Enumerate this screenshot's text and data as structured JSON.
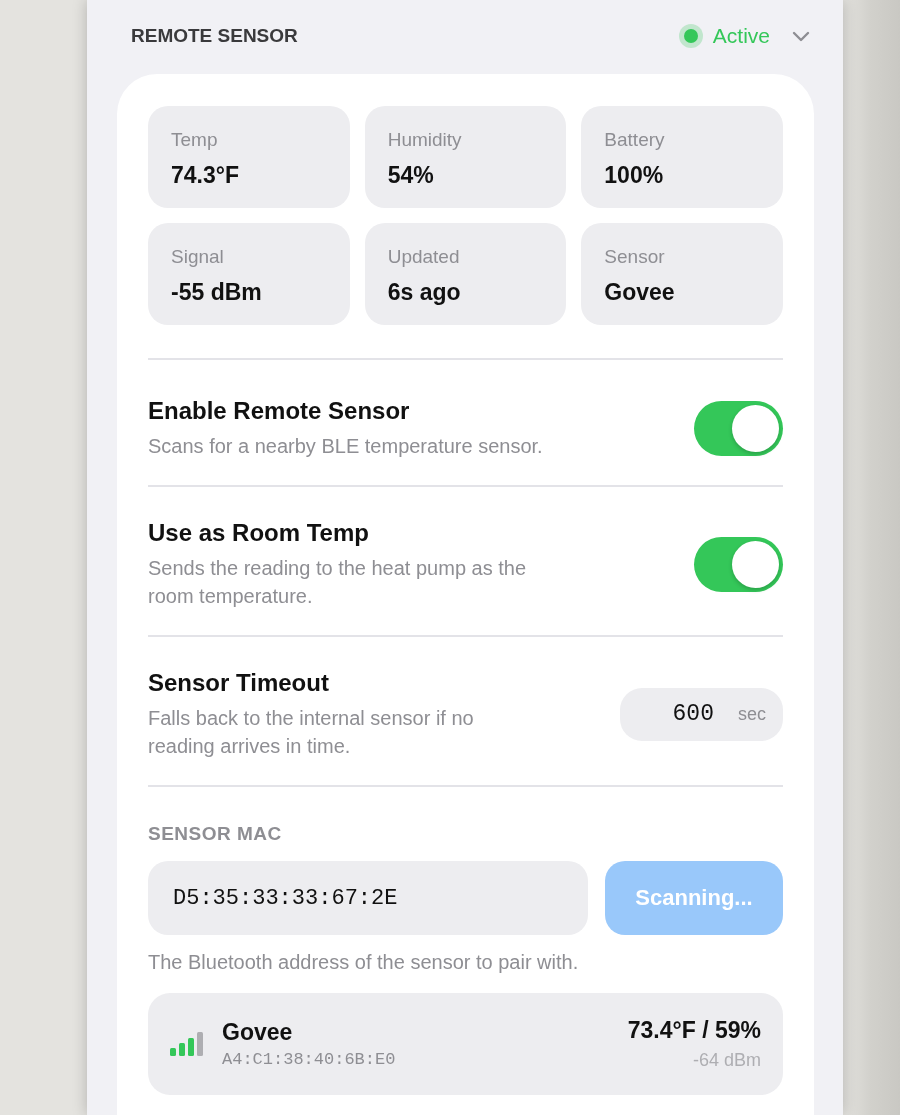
{
  "header": {
    "title": "REMOTE SENSOR",
    "status": {
      "label": "Active",
      "active": true
    }
  },
  "stats": [
    {
      "label": "Temp",
      "value": "74.3°F"
    },
    {
      "label": "Humidity",
      "value": "54%"
    },
    {
      "label": "Battery",
      "value": "100%"
    },
    {
      "label": "Signal",
      "value": "-55 dBm"
    },
    {
      "label": "Updated",
      "value": "6s ago"
    },
    {
      "label": "Sensor",
      "value": "Govee"
    }
  ],
  "settings": [
    {
      "kind": "toggle",
      "title": "Enable Remote Sensor",
      "description": "Scans for a nearby BLE temperature sensor.",
      "on": true
    },
    {
      "kind": "toggle",
      "title": "Use as Room Temp",
      "description": "Sends the reading to the heat pump as the room temperature.",
      "on": true
    },
    {
      "kind": "number",
      "title": "Sensor Timeout",
      "description": "Falls back to the internal sensor if no reading arrives in time.",
      "value": "600",
      "unit": "sec"
    }
  ],
  "mac_section": {
    "label": "SENSOR MAC",
    "value": "D5:35:33:33:67:2E",
    "button": {
      "label": "Scanning...",
      "disabled": true
    },
    "help": "The Bluetooth address of the sensor to pair with."
  },
  "devices": [
    {
      "name": "Govee",
      "mac": "A4:C1:38:40:6B:E0",
      "reading": "73.4°F / 59%",
      "rssi": "-64 dBm"
    }
  ]
}
